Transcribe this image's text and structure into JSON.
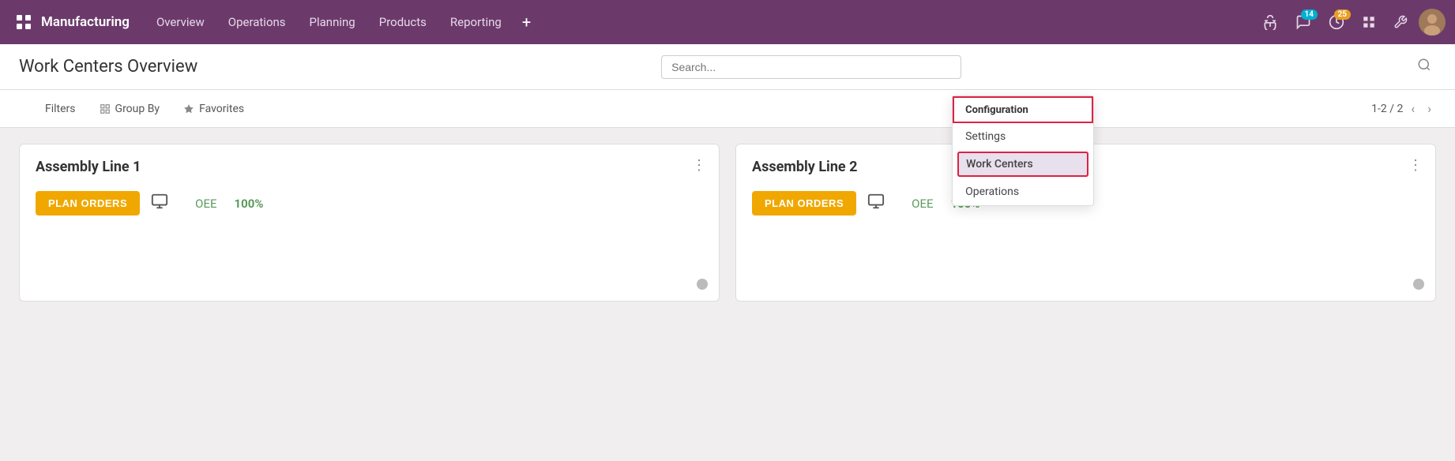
{
  "app": {
    "name": "Manufacturing"
  },
  "topnav": {
    "menu_items": [
      "Overview",
      "Operations",
      "Planning",
      "Products",
      "Reporting"
    ],
    "add_label": "+",
    "icons": {
      "debug": "🐛",
      "chat": "💬",
      "chat_badge": "14",
      "clock": "⏱",
      "clock_badge": "25",
      "grid": "⊞",
      "wrench": "🔧"
    }
  },
  "subheader": {
    "title": "Work Centers Overview",
    "search_placeholder": "Search..."
  },
  "dropdown": {
    "header": "Configuration",
    "items": [
      {
        "label": "Settings",
        "active": false
      },
      {
        "label": "Work Centers",
        "active": true
      },
      {
        "label": "Operations",
        "active": false
      }
    ]
  },
  "filter_bar": {
    "filters_label": "Filters",
    "group_label": "Group By",
    "favorites_label": "Favorites",
    "pagination": "1-2 / 2"
  },
  "cards": [
    {
      "title": "Assembly Line 1",
      "plan_orders_label": "PLAN ORDERS",
      "oee_label": "OEE",
      "oee_value": "100%"
    },
    {
      "title": "Assembly Line 2",
      "plan_orders_label": "PLAN ORDERS",
      "oee_label": "OEE",
      "oee_value": "100%"
    }
  ]
}
